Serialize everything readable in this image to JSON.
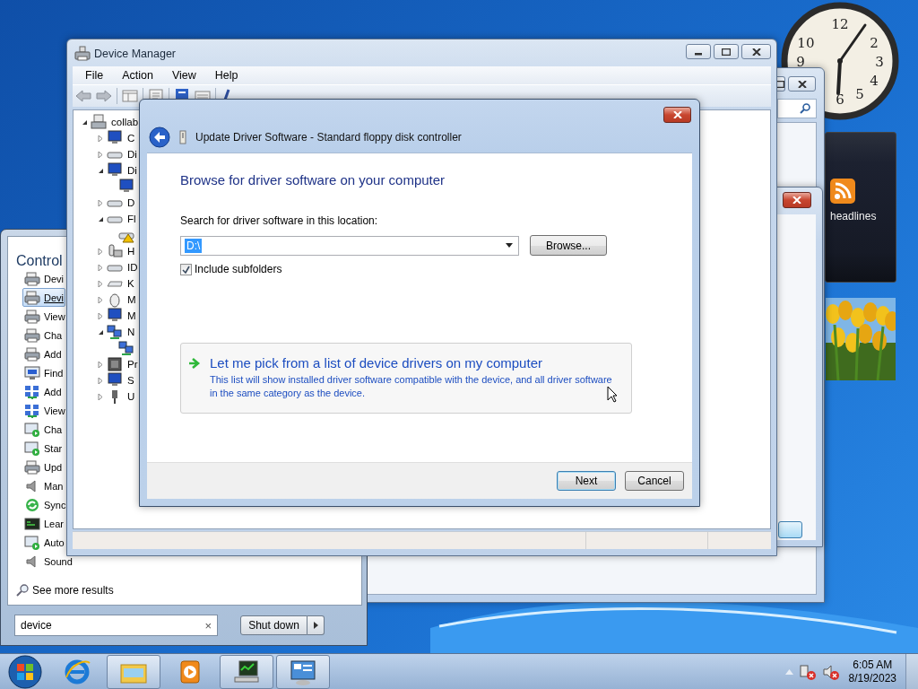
{
  "desktop": {
    "clock_gadget": {
      "numerals": [
        "12",
        "2",
        "3",
        "4",
        "5",
        "6",
        "9",
        "10"
      ]
    },
    "feed_gadget": {
      "label": "headlines"
    }
  },
  "start_menu": {
    "group_title": "Control",
    "results": [
      {
        "label": "Devi",
        "selected": false
      },
      {
        "label": "Devi",
        "selected": true
      },
      {
        "label": "View",
        "selected": false
      },
      {
        "label": "Cha",
        "selected": false
      },
      {
        "label": "Add",
        "selected": false
      },
      {
        "label": "Find",
        "selected": false
      },
      {
        "label": "Add",
        "selected": false
      },
      {
        "label": "View",
        "selected": false
      },
      {
        "label": "Cha",
        "selected": false
      },
      {
        "label": "Star",
        "selected": false
      },
      {
        "label": "Upd",
        "selected": false
      },
      {
        "label": "Man",
        "selected": false
      },
      {
        "label": "Sync",
        "selected": false
      },
      {
        "label": "Lear",
        "selected": false
      },
      {
        "label": "Auto",
        "selected": false
      },
      {
        "label": "Sound",
        "selected": false
      }
    ],
    "see_more": "See more results",
    "search": {
      "value": "device",
      "clear": "×"
    },
    "shut_down": "Shut down"
  },
  "device_manager": {
    "title": "Device Manager",
    "menu": [
      "File",
      "Action",
      "View",
      "Help"
    ],
    "tree": {
      "label": "collab",
      "expanded": true,
      "children": [
        {
          "label": "C",
          "expanded": false
        },
        {
          "label": "Di",
          "expanded": false
        },
        {
          "label": "Di",
          "expanded": true,
          "children": [
            {
              "warning": false
            }
          ]
        },
        {
          "label": "D",
          "expanded": false
        },
        {
          "label": "Fl",
          "expanded": true,
          "children": [
            {
              "warning": true
            }
          ]
        },
        {
          "label": "H",
          "expanded": false
        },
        {
          "label": "ID",
          "expanded": false
        },
        {
          "label": "K",
          "expanded": false
        },
        {
          "label": "M",
          "expanded": false
        },
        {
          "label": "M",
          "expanded": false
        },
        {
          "label": "N",
          "expanded": true,
          "children": [
            {
              "warning": false
            }
          ]
        },
        {
          "label": "Pr",
          "expanded": false
        },
        {
          "label": "S",
          "expanded": false
        },
        {
          "label": "U",
          "expanded": false
        }
      ]
    }
  },
  "dialog": {
    "title": "Update Driver Software - Standard floppy disk controller",
    "heading": "Browse for driver software on your computer",
    "location_label": "Search for driver software in this location:",
    "location": {
      "value": "D:\\",
      "text_selected": true
    },
    "browse": "Browse...",
    "include_subfolders": {
      "label": "Include subfolders",
      "checked": true
    },
    "command_link": {
      "title": "Let me pick from a list of device drivers on my computer",
      "description": "This list will show installed driver software compatible with the device, and all driver software in the same category as the device."
    },
    "buttons": [
      {
        "label": "Next",
        "default": true
      },
      {
        "label": "Cancel",
        "default": false
      }
    ]
  },
  "taskbar": {
    "items": [
      {
        "running": false
      },
      {
        "running": true
      },
      {
        "running": false
      },
      {
        "running": true
      },
      {
        "running": true
      }
    ],
    "time": "6:05 AM",
    "date": "8/19/2023"
  }
}
